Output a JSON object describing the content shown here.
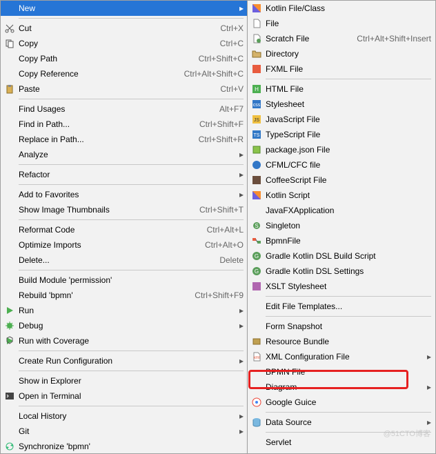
{
  "left_menu": {
    "groups": [
      [
        {
          "label": "New",
          "shortcut": "",
          "submenu": true,
          "highlighted": true,
          "icon": "blank"
        }
      ],
      [
        {
          "label": "Cut",
          "shortcut": "Ctrl+X",
          "icon": "cut"
        },
        {
          "label": "Copy",
          "shortcut": "Ctrl+C",
          "icon": "copy"
        },
        {
          "label": "Copy Path",
          "shortcut": "Ctrl+Shift+C",
          "icon": "blank"
        },
        {
          "label": "Copy Reference",
          "shortcut": "Ctrl+Alt+Shift+C",
          "icon": "blank"
        },
        {
          "label": "Paste",
          "shortcut": "Ctrl+V",
          "icon": "paste"
        }
      ],
      [
        {
          "label": "Find Usages",
          "shortcut": "Alt+F7",
          "icon": "blank"
        },
        {
          "label": "Find in Path...",
          "shortcut": "Ctrl+Shift+F",
          "icon": "blank"
        },
        {
          "label": "Replace in Path...",
          "shortcut": "Ctrl+Shift+R",
          "icon": "blank"
        },
        {
          "label": "Analyze",
          "shortcut": "",
          "submenu": true,
          "icon": "blank"
        }
      ],
      [
        {
          "label": "Refactor",
          "shortcut": "",
          "submenu": true,
          "icon": "blank"
        }
      ],
      [
        {
          "label": "Add to Favorites",
          "shortcut": "",
          "submenu": true,
          "icon": "blank"
        },
        {
          "label": "Show Image Thumbnails",
          "shortcut": "Ctrl+Shift+T",
          "icon": "blank"
        }
      ],
      [
        {
          "label": "Reformat Code",
          "shortcut": "Ctrl+Alt+L",
          "icon": "blank"
        },
        {
          "label": "Optimize Imports",
          "shortcut": "Ctrl+Alt+O",
          "icon": "blank"
        },
        {
          "label": "Delete...",
          "shortcut": "Delete",
          "icon": "blank"
        }
      ],
      [
        {
          "label": "Build Module 'permission'",
          "shortcut": "",
          "icon": "blank"
        },
        {
          "label": "Rebuild 'bpmn'",
          "shortcut": "Ctrl+Shift+F9",
          "icon": "blank"
        },
        {
          "label": "Run",
          "shortcut": "",
          "submenu": true,
          "icon": "run"
        },
        {
          "label": "Debug",
          "shortcut": "",
          "submenu": true,
          "icon": "debug"
        },
        {
          "label": "Run with Coverage",
          "shortcut": "",
          "icon": "coverage"
        }
      ],
      [
        {
          "label": "Create Run Configuration",
          "shortcut": "",
          "submenu": true,
          "icon": "blank"
        }
      ],
      [
        {
          "label": "Show in Explorer",
          "shortcut": "",
          "icon": "blank"
        },
        {
          "label": "Open in Terminal",
          "shortcut": "",
          "icon": "terminal"
        }
      ],
      [
        {
          "label": "Local History",
          "shortcut": "",
          "submenu": true,
          "icon": "blank"
        },
        {
          "label": "Git",
          "shortcut": "",
          "submenu": true,
          "icon": "blank"
        },
        {
          "label": "Synchronize 'bpmn'",
          "shortcut": "",
          "icon": "sync"
        }
      ]
    ]
  },
  "right_menu": {
    "groups": [
      [
        {
          "label": "Kotlin File/Class",
          "icon": "kotlin"
        },
        {
          "label": "File",
          "icon": "file"
        },
        {
          "label": "Scratch File",
          "shortcut": "Ctrl+Alt+Shift+Insert",
          "icon": "scratch"
        },
        {
          "label": "Directory",
          "icon": "folder"
        },
        {
          "label": "FXML File",
          "icon": "fxml"
        }
      ],
      [
        {
          "label": "HTML File",
          "icon": "html"
        },
        {
          "label": "Stylesheet",
          "icon": "css"
        },
        {
          "label": "JavaScript File",
          "icon": "js"
        },
        {
          "label": "TypeScript File",
          "icon": "ts"
        },
        {
          "label": "package.json File",
          "icon": "pkg"
        },
        {
          "label": "CFML/CFC file",
          "icon": "cfml"
        },
        {
          "label": "CoffeeScript File",
          "icon": "coffee"
        },
        {
          "label": "Kotlin Script",
          "icon": "kotlin"
        },
        {
          "label": "JavaFXApplication",
          "icon": "blank"
        },
        {
          "label": "Singleton",
          "icon": "singleton"
        },
        {
          "label": "BpmnFile",
          "icon": "bpmn"
        },
        {
          "label": "Gradle Kotlin DSL Build Script",
          "icon": "gradle"
        },
        {
          "label": "Gradle Kotlin DSL Settings",
          "icon": "gradle"
        },
        {
          "label": "XSLT Stylesheet",
          "icon": "xslt"
        }
      ],
      [
        {
          "label": "Edit File Templates...",
          "icon": "blank"
        }
      ],
      [
        {
          "label": "Form Snapshot",
          "icon": "blank"
        },
        {
          "label": "Resource Bundle",
          "icon": "bundle"
        },
        {
          "label": "XML Configuration File",
          "submenu": true,
          "icon": "xml"
        },
        {
          "label": "BPMN File",
          "icon": "blank"
        },
        {
          "label": "Diagram",
          "submenu": true,
          "icon": "blank"
        },
        {
          "label": "Google Guice",
          "icon": "guice"
        }
      ],
      [
        {
          "label": "Data Source",
          "submenu": true,
          "icon": "datasource"
        }
      ],
      [
        {
          "label": "Servlet",
          "icon": "blank"
        }
      ]
    ]
  },
  "watermark": "@51CTO博客"
}
